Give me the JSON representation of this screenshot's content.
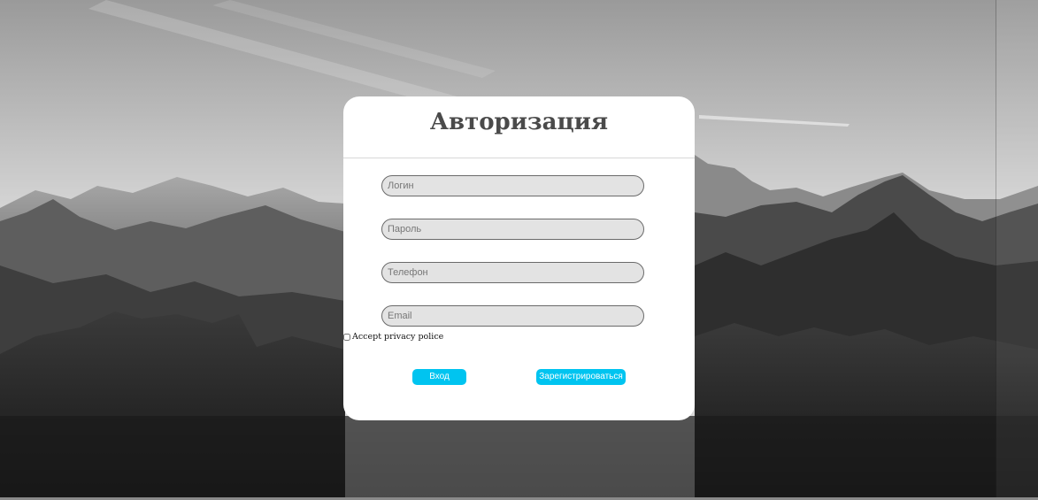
{
  "background": {
    "description_icon": "mountains-background"
  },
  "form": {
    "title": "Авторизация",
    "fields": [
      {
        "name": "login",
        "placeholder": "Логин",
        "value": ""
      },
      {
        "name": "password",
        "placeholder": "Пароль",
        "value": ""
      },
      {
        "name": "phone",
        "placeholder": "Телефон",
        "value": ""
      },
      {
        "name": "email",
        "placeholder": "Email",
        "value": ""
      }
    ],
    "privacy_label": "Accept privacy police",
    "privacy_checked": false,
    "login_button": "Вход",
    "register_button": "Зарегистрироваться"
  },
  "colors": {
    "accent": "#00c4f0",
    "card": "#ffffff",
    "field_bg": "#e3e3e3",
    "title": "#4a4a4a"
  }
}
